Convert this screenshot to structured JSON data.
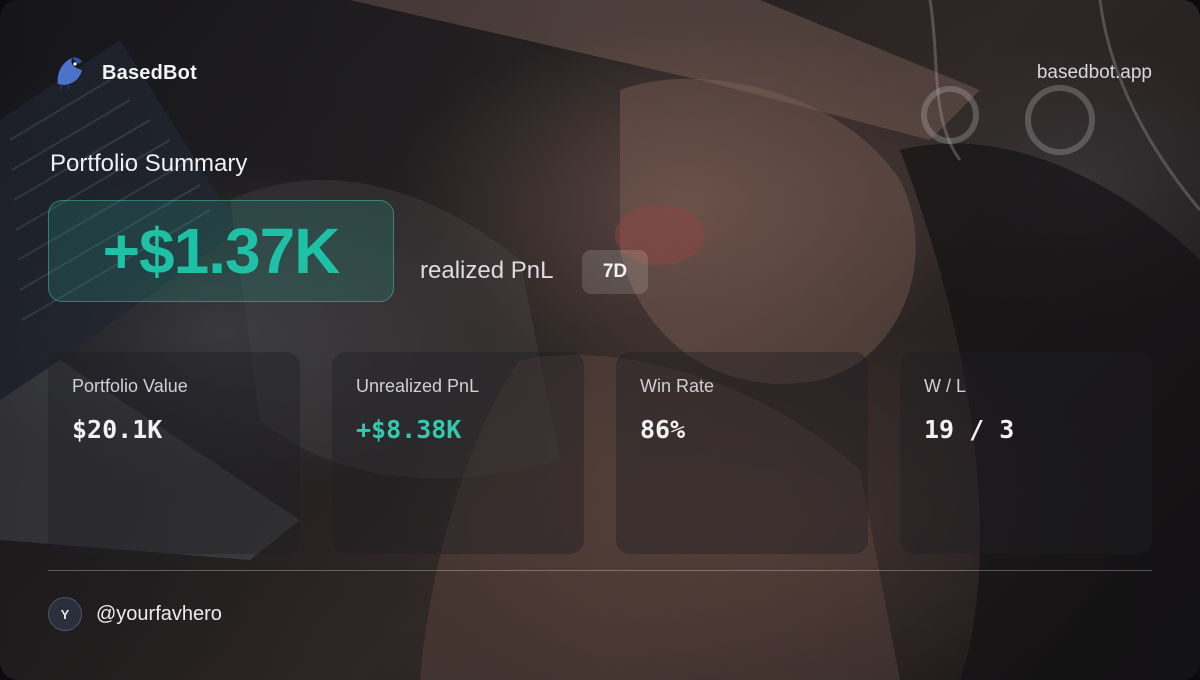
{
  "brand": {
    "name": "BasedBot",
    "logo_icon": "bird-logo-icon",
    "site": "basedbot.app"
  },
  "summary": {
    "title": "Portfolio Summary",
    "realized_pnl": "+$1.37K",
    "realized_label": "realized PnL",
    "period": "7D"
  },
  "stats": [
    {
      "label": "Portfolio Value",
      "value": "$20.1K"
    },
    {
      "label": "Unrealized PnL",
      "value": "+$8.38K"
    },
    {
      "label": "Win Rate",
      "value": "86%"
    },
    {
      "label": "W / L",
      "value": "19 / 3"
    }
  ],
  "user": {
    "avatar_initial": "Y",
    "handle": "@yourfavhero"
  },
  "colors": {
    "accent_teal": "#1fc1a6",
    "positive": "#34c9ad",
    "card_bg": "#1e1e24"
  }
}
